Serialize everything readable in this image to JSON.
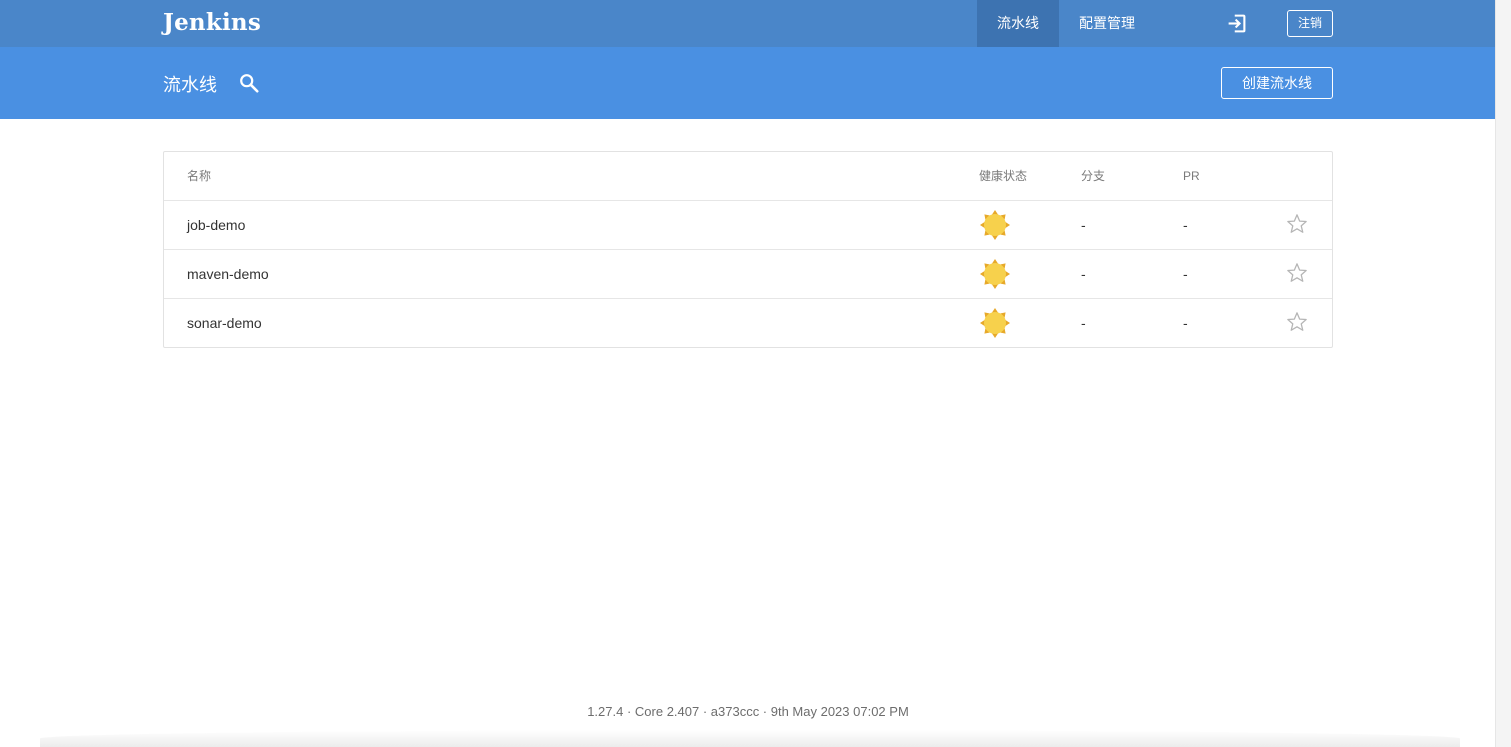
{
  "topbar": {
    "brand": "Jenkins",
    "tabs": [
      {
        "label": "流水线",
        "active": true
      },
      {
        "label": "配置管理",
        "active": false
      }
    ],
    "logout_icon": "logout-arrow-icon",
    "logout_label": "注销"
  },
  "subheader": {
    "title": "流水线",
    "search_icon": "search-icon",
    "create_label": "创建流水线"
  },
  "table": {
    "columns": [
      "名称",
      "健康状态",
      "分支",
      "PR"
    ],
    "rows": [
      {
        "name": "job-demo",
        "health": "sunny-icon",
        "branch": "-",
        "pr": "-",
        "favorite": false
      },
      {
        "name": "maven-demo",
        "health": "sunny-icon",
        "branch": "-",
        "pr": "-",
        "favorite": false
      },
      {
        "name": "sonar-demo",
        "health": "sunny-icon",
        "branch": "-",
        "pr": "-",
        "favorite": false
      }
    ]
  },
  "footer": {
    "version_text": "1.27.4 · Core 2.407 · a373ccc · 9th May 2023 07:02 PM"
  },
  "colors": {
    "topbar": "#4a86c9",
    "active_tab": "#3d73b1",
    "subheader": "#4a90e2",
    "sun_fill": "#f7d14c",
    "sun_rays": "#e7a92a"
  }
}
